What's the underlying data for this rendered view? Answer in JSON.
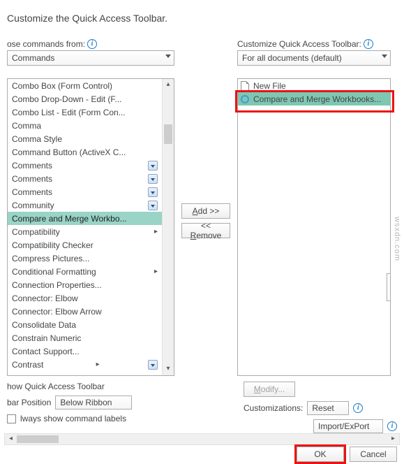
{
  "title": "Customize the Quick Access Toolbar.",
  "choose_label": "ose commands from:",
  "choose_value": "Commands",
  "customize_label": "Customize Quick Access Toolbar:",
  "customize_value": "For all documents (default)",
  "left_items": [
    {
      "label": "Combo Box (Form Control)",
      "sub": false,
      "dd": false,
      "sel": false
    },
    {
      "label": "Combo Drop-Down - Edit (F...",
      "sub": false,
      "dd": false,
      "sel": false
    },
    {
      "label": "Combo List - Edit (Form Con...",
      "sub": false,
      "dd": false,
      "sel": false
    },
    {
      "label": "Comma",
      "sub": false,
      "dd": false,
      "sel": false
    },
    {
      "label": "Comma Style",
      "sub": false,
      "dd": false,
      "sel": false
    },
    {
      "label": "Command Button (ActiveX C...",
      "sub": false,
      "dd": false,
      "sel": false
    },
    {
      "label": "Comments",
      "sub": false,
      "dd": true,
      "sel": false
    },
    {
      "label": "Comments",
      "sub": false,
      "dd": true,
      "sel": false
    },
    {
      "label": "Comments",
      "sub": false,
      "dd": true,
      "sel": false
    },
    {
      "label": "Community",
      "sub": false,
      "dd": true,
      "sel": false
    },
    {
      "label": "Compare and Merge Workbo...",
      "sub": false,
      "dd": false,
      "sel": true
    },
    {
      "label": "Compatibility",
      "sub": true,
      "dd": false,
      "sel": false
    },
    {
      "label": "Compatibility Checker",
      "sub": false,
      "dd": false,
      "sel": false
    },
    {
      "label": "Compress Pictures...",
      "sub": false,
      "dd": false,
      "sel": false
    },
    {
      "label": "Conditional Formatting",
      "sub": true,
      "dd": false,
      "sel": false
    },
    {
      "label": "Connection Properties...",
      "sub": false,
      "dd": false,
      "sel": false
    },
    {
      "label": "Connector: Elbow",
      "sub": false,
      "dd": false,
      "sel": false
    },
    {
      "label": "Connector: Elbow Arrow",
      "sub": false,
      "dd": false,
      "sel": false
    },
    {
      "label": "Consolidate Data",
      "sub": false,
      "dd": false,
      "sel": false
    },
    {
      "label": "Constrain Numeric",
      "sub": false,
      "dd": false,
      "sel": false
    },
    {
      "label": "Contact Support...",
      "sub": false,
      "dd": false,
      "sel": false
    },
    {
      "label": "Contrast",
      "sub": true,
      "dd": true,
      "sel": false
    }
  ],
  "right_items": [
    {
      "icon": "doc",
      "label": "New File"
    },
    {
      "icon": "ring",
      "label": "Compare and Merge Workbooks..."
    }
  ],
  "btn_add": "Add >>",
  "btn_remove_prefix": "<< ",
  "btn_remove_u": "R",
  "btn_remove_rest": "emove",
  "show_toolbar_label": "how Quick Access Toolbar",
  "bar_position_label": "bar Position",
  "bar_position_value": "Below Ribbon",
  "always_show_label": "lways show command labels",
  "modify_u": "M",
  "modify_rest": "odify...",
  "customizations_label": "Customizations:",
  "reset_u": "R",
  "reset_rest": "eset",
  "import_export_u": "P",
  "import_export_pre": "Import/Ex",
  "import_export_post": "ort",
  "ok_label": "OK",
  "cancel_label": "Cancel",
  "watermark": "wsxdn.com"
}
